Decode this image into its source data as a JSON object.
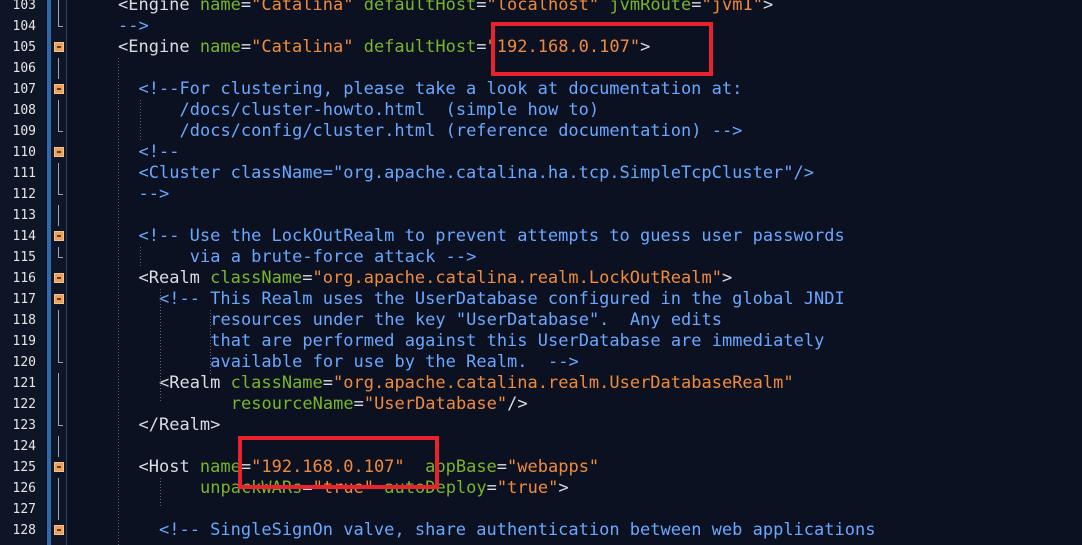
{
  "highlight_color": "#e8232e",
  "lines": [
    {
      "n": "103",
      "fold": "vline",
      "indent": 4,
      "tokens": [
        {
          "t": "<Engine ",
          "c": "tag"
        },
        {
          "t": "name",
          "c": "attr"
        },
        {
          "t": "=",
          "c": "plain"
        },
        {
          "t": "\"Catalina\"",
          "c": "val"
        },
        {
          "t": " ",
          "c": "plain"
        },
        {
          "t": "defaultHost",
          "c": "attr"
        },
        {
          "t": "=",
          "c": "plain"
        },
        {
          "t": "\"localhost\"",
          "c": "val"
        },
        {
          "t": " ",
          "c": "plain"
        },
        {
          "t": "jvmRoute",
          "c": "attr"
        },
        {
          "t": "=",
          "c": "plain"
        },
        {
          "t": "\"jvm1\"",
          "c": "val"
        },
        {
          "t": ">",
          "c": "tag"
        }
      ]
    },
    {
      "n": "104",
      "fold": "end",
      "indent": 4,
      "tokens": [
        {
          "t": "-->",
          "c": "com"
        }
      ]
    },
    {
      "n": "105",
      "fold": "box",
      "indent": 4,
      "tokens": [
        {
          "t": "<Engine ",
          "c": "tag"
        },
        {
          "t": "name",
          "c": "attr"
        },
        {
          "t": "=",
          "c": "plain"
        },
        {
          "t": "\"Catalina\"",
          "c": "val"
        },
        {
          "t": " ",
          "c": "plain"
        },
        {
          "t": "defaultHost",
          "c": "attr"
        },
        {
          "t": "=",
          "c": "plain"
        },
        {
          "t": "\"192.168.0.107\"",
          "c": "val"
        },
        {
          "t": ">",
          "c": "tag"
        }
      ]
    },
    {
      "n": "106",
      "fold": "vline",
      "indent": 0,
      "tokens": []
    },
    {
      "n": "107",
      "fold": "box",
      "indent": 6,
      "tokens": [
        {
          "t": "<!--For clustering, please take a look at documentation at:",
          "c": "com"
        }
      ]
    },
    {
      "n": "108",
      "fold": "vline",
      "indent": 10,
      "tokens": [
        {
          "t": "/docs/cluster-howto.html  (simple how to)",
          "c": "com"
        }
      ]
    },
    {
      "n": "109",
      "fold": "end",
      "indent": 10,
      "tokens": [
        {
          "t": "/docs/config/cluster.html (reference documentation) -->",
          "c": "com"
        }
      ]
    },
    {
      "n": "110",
      "fold": "box",
      "indent": 6,
      "tokens": [
        {
          "t": "<!--",
          "c": "com"
        }
      ]
    },
    {
      "n": "111",
      "fold": "vline",
      "indent": 6,
      "tokens": [
        {
          "t": "<Cluster className=\"org.apache.catalina.ha.tcp.SimpleTcpCluster\"/>",
          "c": "com"
        }
      ]
    },
    {
      "n": "112",
      "fold": "end",
      "indent": 6,
      "tokens": [
        {
          "t": "-->",
          "c": "com"
        }
      ]
    },
    {
      "n": "113",
      "fold": "vline",
      "indent": 0,
      "tokens": []
    },
    {
      "n": "114",
      "fold": "box",
      "indent": 6,
      "tokens": [
        {
          "t": "<!-- Use the LockOutRealm to prevent attempts to guess user passwords",
          "c": "com"
        }
      ]
    },
    {
      "n": "115",
      "fold": "end",
      "indent": 11,
      "tokens": [
        {
          "t": "via a brute-force attack -->",
          "c": "com"
        }
      ]
    },
    {
      "n": "116",
      "fold": "box",
      "indent": 6,
      "tokens": [
        {
          "t": "<Realm ",
          "c": "tag"
        },
        {
          "t": "className",
          "c": "attr"
        },
        {
          "t": "=",
          "c": "plain"
        },
        {
          "t": "\"org.apache.catalina.realm.LockOutRealm\"",
          "c": "val"
        },
        {
          "t": ">",
          "c": "tag"
        }
      ]
    },
    {
      "n": "117",
      "fold": "box",
      "indent": 8,
      "tokens": [
        {
          "t": "<!-- This Realm uses the UserDatabase configured in the global JNDI",
          "c": "com"
        }
      ]
    },
    {
      "n": "118",
      "fold": "vline",
      "indent": 13,
      "tokens": [
        {
          "t": "resources under the key \"UserDatabase\".  Any edits",
          "c": "com"
        }
      ]
    },
    {
      "n": "119",
      "fold": "vline",
      "indent": 13,
      "tokens": [
        {
          "t": "that are performed against this UserDatabase are immediately",
          "c": "com"
        }
      ]
    },
    {
      "n": "120",
      "fold": "end",
      "indent": 13,
      "tokens": [
        {
          "t": "available for use by the Realm.  -->",
          "c": "com"
        }
      ]
    },
    {
      "n": "121",
      "fold": "vline",
      "indent": 8,
      "tokens": [
        {
          "t": "<Realm ",
          "c": "tag"
        },
        {
          "t": "className",
          "c": "attr"
        },
        {
          "t": "=",
          "c": "plain"
        },
        {
          "t": "\"org.apache.catalina.realm.UserDatabaseRealm\"",
          "c": "val"
        }
      ]
    },
    {
      "n": "122",
      "fold": "vline",
      "indent": 15,
      "tokens": [
        {
          "t": "resourceName",
          "c": "attr"
        },
        {
          "t": "=",
          "c": "plain"
        },
        {
          "t": "\"UserDatabase\"",
          "c": "val"
        },
        {
          "t": "/>",
          "c": "tag"
        }
      ]
    },
    {
      "n": "123",
      "fold": "end",
      "indent": 6,
      "tokens": [
        {
          "t": "</Realm>",
          "c": "tag"
        }
      ]
    },
    {
      "n": "124",
      "fold": "vline",
      "indent": 0,
      "tokens": []
    },
    {
      "n": "125",
      "fold": "box",
      "indent": 6,
      "tokens": [
        {
          "t": "<Host ",
          "c": "tag"
        },
        {
          "t": "name",
          "c": "attr"
        },
        {
          "t": "=",
          "c": "plain"
        },
        {
          "t": "\"192.168.0.107\"",
          "c": "val"
        },
        {
          "t": "  ",
          "c": "plain"
        },
        {
          "t": "appBase",
          "c": "attr"
        },
        {
          "t": "=",
          "c": "plain"
        },
        {
          "t": "\"webapps\"",
          "c": "val"
        }
      ]
    },
    {
      "n": "126",
      "fold": "vline",
      "indent": 12,
      "tokens": [
        {
          "t": "unpackWARs",
          "c": "attr"
        },
        {
          "t": "=",
          "c": "plain"
        },
        {
          "t": "\"true\"",
          "c": "val"
        },
        {
          "t": " ",
          "c": "plain"
        },
        {
          "t": "autoDeploy",
          "c": "attr"
        },
        {
          "t": "=",
          "c": "plain"
        },
        {
          "t": "\"true\"",
          "c": "val"
        },
        {
          "t": ">",
          "c": "tag"
        }
      ]
    },
    {
      "n": "127",
      "fold": "vline",
      "indent": 0,
      "tokens": []
    },
    {
      "n": "128",
      "fold": "box",
      "indent": 8,
      "tokens": [
        {
          "t": "<!-- SingleSignOn valve, share authentication between web applications",
          "c": "com"
        }
      ]
    }
  ]
}
